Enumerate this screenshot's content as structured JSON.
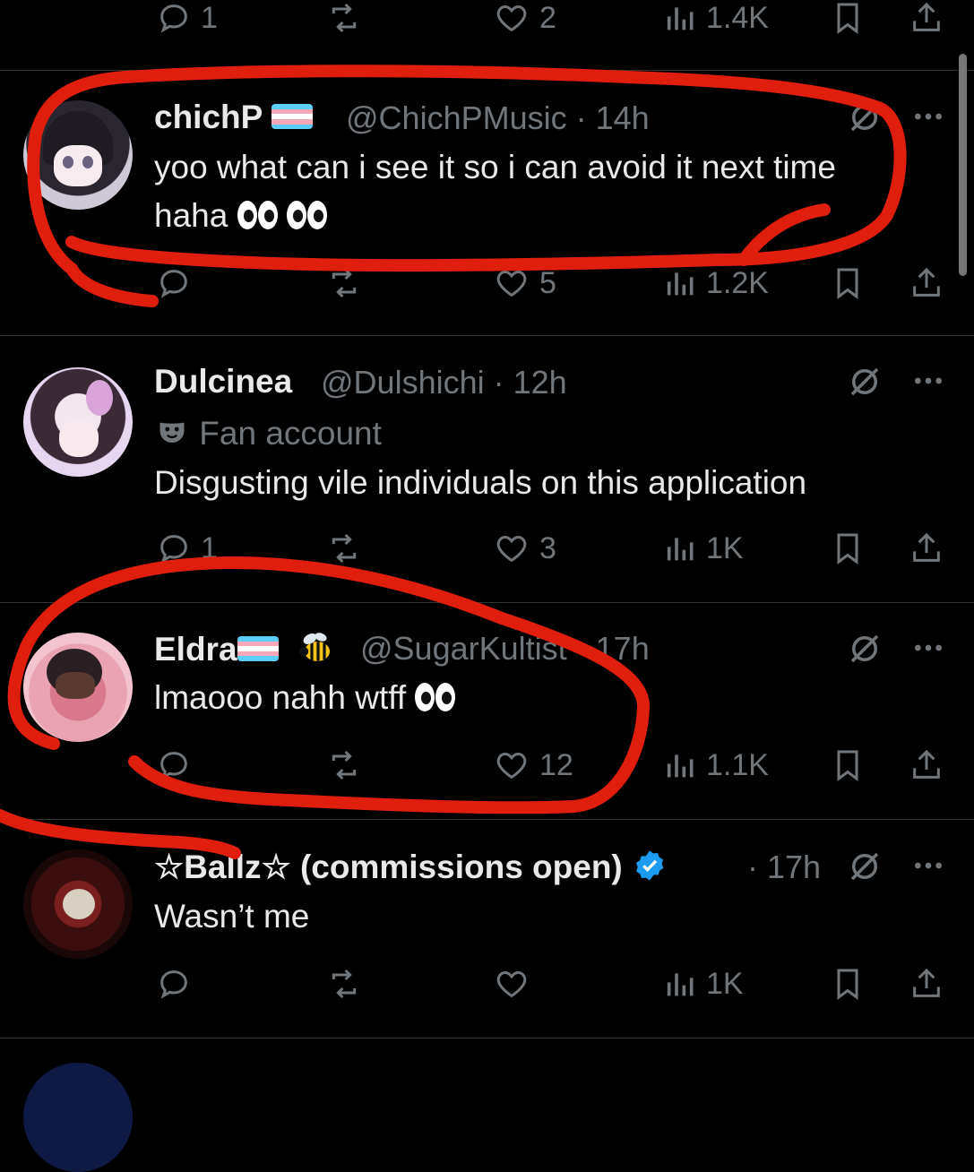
{
  "top_actions": {
    "replies": "1",
    "reposts": "",
    "likes": "2",
    "views": "1.4K"
  },
  "tweets": [
    {
      "name": "chichP",
      "handle": "@ChichPMusic",
      "time": "14h",
      "text_line1": "yoo what can i see it so i can avoid it next time",
      "text_line2": "haha",
      "actions": {
        "replies": "",
        "reposts": "",
        "likes": "5",
        "views": "1.2K"
      }
    },
    {
      "name": "Dulcinea",
      "handle": "@Dulshichi",
      "time": "12h",
      "label": "Fan account",
      "text": "Disgusting vile individuals on this application",
      "actions": {
        "replies": "1",
        "reposts": "",
        "likes": "3",
        "views": "1K"
      }
    },
    {
      "name": "Eldra",
      "handle": "@SugarKultist",
      "time": "17h",
      "text": "lmaooo nahh wtff",
      "actions": {
        "replies": "",
        "reposts": "",
        "likes": "12",
        "views": "1.1K"
      }
    },
    {
      "name": "☆Ballz☆ (commissions open)",
      "time": "17h",
      "text": "Wasn’t me",
      "actions": {
        "replies": "",
        "reposts": "",
        "likes": "",
        "views": "1K"
      }
    }
  ],
  "colors": {
    "background": "#000000",
    "text": "#e7e9ea",
    "muted": "#71767b",
    "verified": "#1d9bf0",
    "annotation": "#e01e0e"
  }
}
